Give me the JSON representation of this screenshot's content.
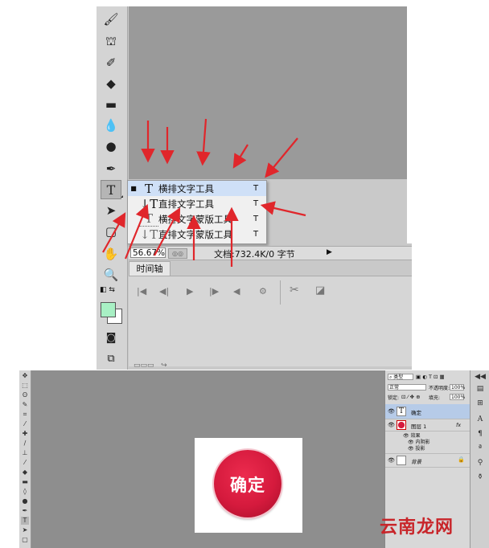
{
  "flyout": {
    "items": [
      {
        "label": "横排文字工具",
        "shortcut": "T",
        "icon": "T",
        "selected": true
      },
      {
        "label": "直排文字工具",
        "shortcut": "T",
        "icon": "↓T"
      },
      {
        "label": "横排文字蒙版工具",
        "shortcut": "T",
        "icon": "T"
      },
      {
        "label": "直排文字蒙版工具",
        "shortcut": "T",
        "icon": "↓T"
      }
    ]
  },
  "status": {
    "zoom": "56.67%",
    "doc_info": "文档:732.4K/0 字节"
  },
  "timeline": {
    "tab_label": "时间轴"
  },
  "button_preview": {
    "label": "确定"
  },
  "layers": {
    "filter_kind": "类型",
    "blend_mode": "正常",
    "opacity_label": "不透明度:",
    "opacity_value": "100%",
    "lock_label": "锁定:",
    "fill_label": "填充:",
    "fill_value": "100%",
    "items": [
      {
        "name": "确定",
        "type": "text",
        "selected": true
      },
      {
        "name": "图层 1",
        "type": "shape",
        "fx": "fx"
      },
      {
        "name": "效果",
        "type": "effects"
      },
      {
        "name": "内阴影",
        "type": "effect"
      },
      {
        "name": "投影",
        "type": "effect"
      },
      {
        "name": "背景",
        "type": "background"
      }
    ]
  },
  "watermark": "云南龙网",
  "colors": {
    "arrow": "#e0262b",
    "button_red": "#d51a3d",
    "foreground_swatch": "#a8f0c4",
    "selected_layer": "#b6cbe8"
  }
}
